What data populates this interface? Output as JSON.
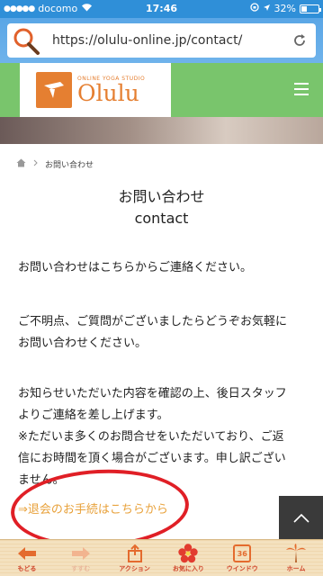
{
  "status": {
    "carrier": "docomo",
    "time": "17:46",
    "battery": "32%"
  },
  "browser": {
    "url": "https://olulu-online.jp/contact/"
  },
  "site": {
    "logo_sub": "ONLINE YOGA STUDIO",
    "logo_name": "Olulu"
  },
  "breadcrumb": {
    "current": "お問い合わせ"
  },
  "page": {
    "title_ja": "お問い合わせ",
    "title_en": "contact",
    "para1": "お問い合わせはこちらからご連絡ください。",
    "para2_line1": "ご不明点、ご質問がございましたらどうぞお気軽に",
    "para2_line2": "お問い合わせください。",
    "para3_line1": "お知らせいただいた内容を確認の上、後日スタッフ",
    "para3_line2": "よりご連絡を差し上げます。",
    "para3_line3": "※ただいま多くのお問合せをいただいており、ご返",
    "para3_line4": "信にお時間を頂く場合がございます。申し訳ござい",
    "para3_line5": "ません。",
    "withdraw_link": "⇒退会のお手続はこちらから"
  },
  "toolbar": {
    "back": "もどる",
    "forward": "すすむ",
    "action": "アクション",
    "favorites": "お気に入り",
    "windows": "ウインドウ",
    "windows_count": "36",
    "home": "ホーム"
  },
  "colors": {
    "accent": "#e57f31",
    "header_green": "#79c56c",
    "link": "#e8a13a",
    "annotation": "#e01f26"
  }
}
